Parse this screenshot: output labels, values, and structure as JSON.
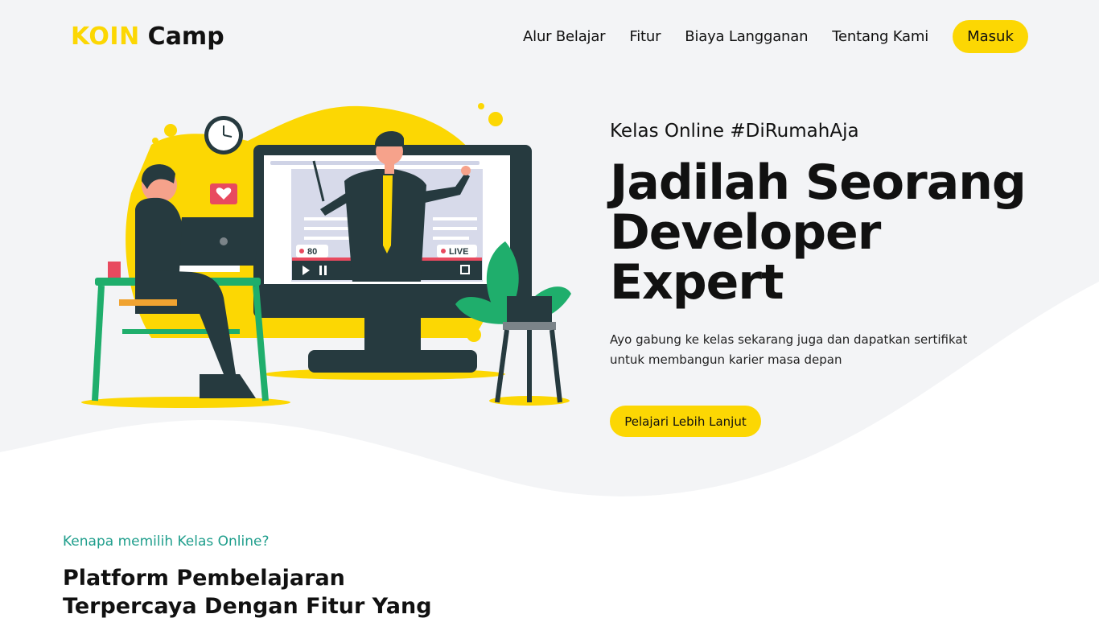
{
  "header": {
    "logo_koin": "KOIN",
    "logo_camp": "Camp",
    "nav": [
      "Alur Belajar",
      "Fitur",
      "Biaya Langganan",
      "Tentang Kami"
    ],
    "login_label": "Masuk"
  },
  "hero": {
    "eyebrow": "Kelas Online #DiRumahAja",
    "title_line1": "Jadilah Seorang",
    "title_line2": "Developer Expert",
    "description": "Ayo gabung ke kelas sekarang juga dan dapatkan sertifikat untuk membangun karier masa depan",
    "cta_label": "Pelajari Lebih Lanjut",
    "live_label": "LIVE",
    "viewer_count": "80"
  },
  "section2": {
    "eyebrow": "Kenapa memilih Kelas Online?",
    "title": "Platform Pembelajaran Terpercaya Dengan Fitur Yang Sangat Menarik"
  },
  "colors": {
    "brand_yellow": "#fcd703",
    "hero_bg": "#f3f4f6",
    "accent_teal": "#1f9e8c",
    "dark": "#263a3f"
  }
}
